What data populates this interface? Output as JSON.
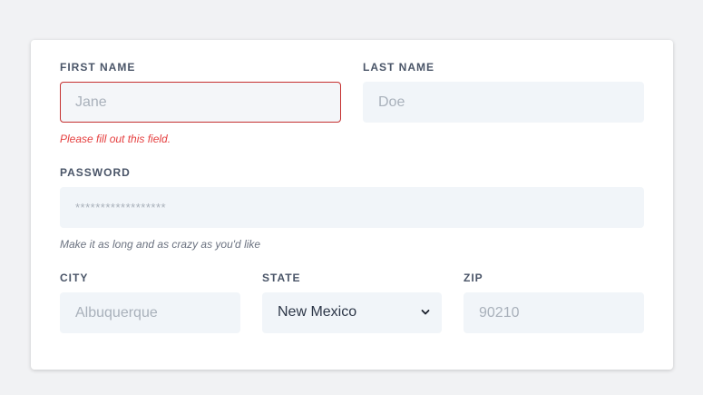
{
  "form": {
    "first_name": {
      "label": "First Name",
      "placeholder": "Jane",
      "error": "Please fill out this field."
    },
    "last_name": {
      "label": "Last Name",
      "placeholder": "Doe"
    },
    "password": {
      "label": "Password",
      "placeholder": "******************",
      "help": "Make it as long and as crazy as you'd like"
    },
    "city": {
      "label": "City",
      "placeholder": "Albuquerque"
    },
    "state": {
      "label": "State",
      "selected": "New Mexico"
    },
    "zip": {
      "label": "Zip",
      "placeholder": "90210"
    }
  },
  "colors": {
    "page_background": "#f1f2f4",
    "card_background": "#ffffff",
    "input_background": "#f1f5f9",
    "error": "#e53e3e",
    "label": "#4a5568"
  },
  "icons": {
    "state_dropdown": "chevron-down-icon"
  }
}
